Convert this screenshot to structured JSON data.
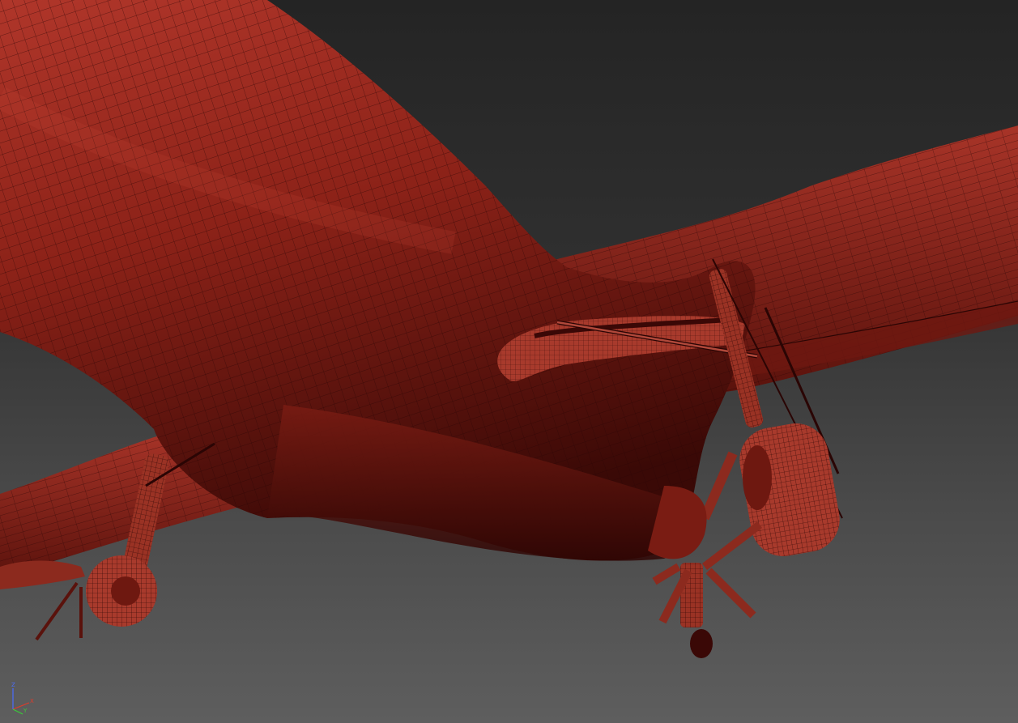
{
  "viewport": {
    "background_top": "#242424",
    "background_bottom": "#5e5e5e",
    "mesh_color": "#8e2419",
    "mesh_shadow": "#4a0d08",
    "wire_color": "#2a0504"
  },
  "axis_gizmo": {
    "z_label": "Z",
    "x_label": "X",
    "y_label": "Y",
    "z_color": "#4a6cff",
    "x_color": "#e03a2a",
    "y_color": "#3acb3a"
  }
}
